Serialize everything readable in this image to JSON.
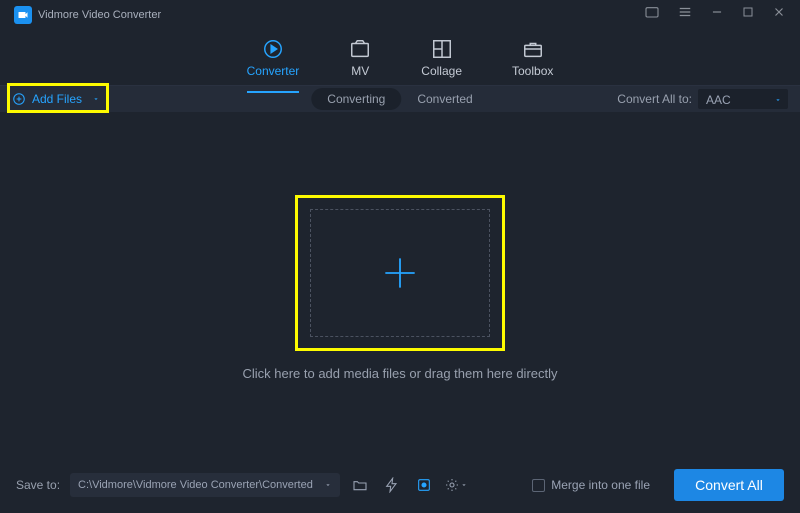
{
  "app": {
    "title": "Vidmore Video Converter"
  },
  "tabs": {
    "converter": "Converter",
    "mv": "MV",
    "collage": "Collage",
    "toolbox": "Toolbox"
  },
  "subbar": {
    "add_files": "Add Files",
    "converting": "Converting",
    "converted": "Converted",
    "convert_all_label": "Convert All to:",
    "convert_all_value": "AAC"
  },
  "main": {
    "drop_hint": "Click here to add media files or drag them here directly"
  },
  "bottom": {
    "save_to_label": "Save to:",
    "save_path": "C:\\Vidmore\\Vidmore Video Converter\\Converted",
    "merge_label": "Merge into one file",
    "convert_all_btn": "Convert All"
  },
  "colors": {
    "accent": "#26a4ff",
    "highlight": "#fdfb00"
  }
}
